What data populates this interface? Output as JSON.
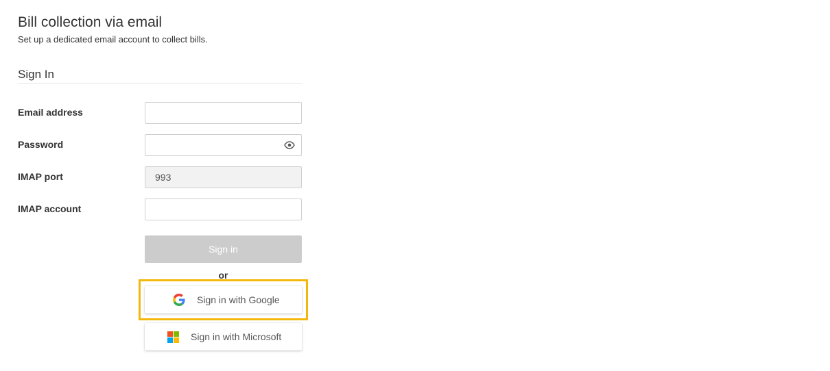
{
  "header": {
    "title": "Bill collection via email",
    "subtitle": "Set up a dedicated email account to collect bills."
  },
  "section": {
    "title": "Sign In"
  },
  "form": {
    "email": {
      "label": "Email address",
      "value": "",
      "placeholder": ""
    },
    "password": {
      "label": "Password",
      "value": "",
      "placeholder": "",
      "toggle_icon": "eye-icon"
    },
    "imap_port": {
      "label": "IMAP port",
      "value": "993",
      "disabled": true
    },
    "imap_account": {
      "label": "IMAP account",
      "value": "",
      "placeholder": ""
    }
  },
  "actions": {
    "signin_label": "Sign in",
    "or_label": "or",
    "google_label": "Sign in with Google",
    "microsoft_label": "Sign in with Microsoft"
  },
  "colors": {
    "highlight": "#f4b70c",
    "disabled_button": "#cccccc",
    "google_blue": "#4285F4",
    "google_red": "#EA4335",
    "google_yellow": "#FBBC05",
    "google_green": "#34A853",
    "ms_red": "#F25022",
    "ms_green": "#7FBA00",
    "ms_blue": "#00A4EF",
    "ms_yellow": "#FFB900"
  }
}
